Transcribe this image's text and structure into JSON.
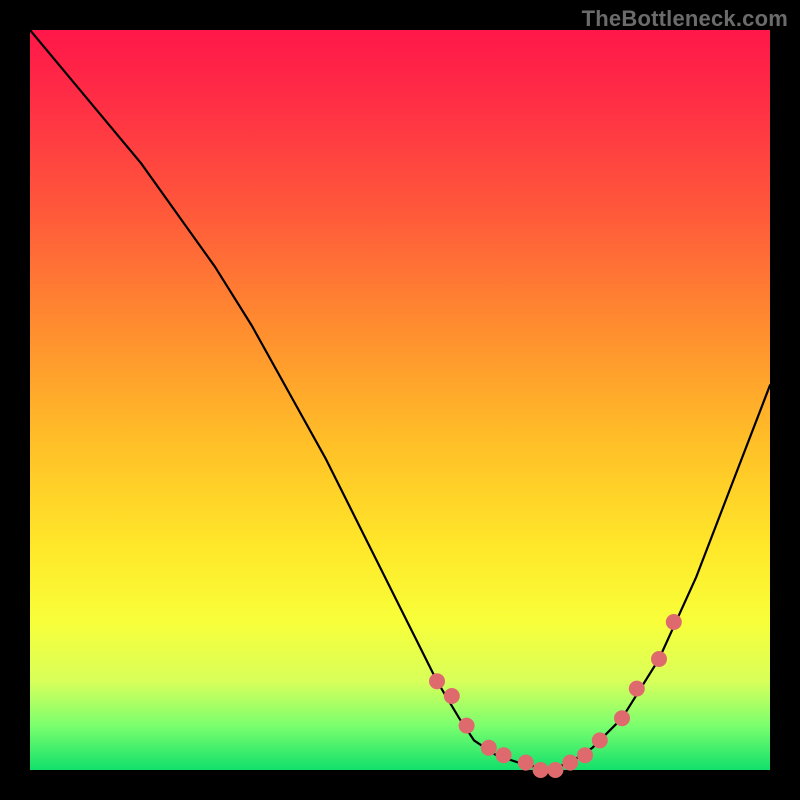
{
  "watermark": "TheBottleneck.com",
  "chart_data": {
    "type": "line",
    "title": "",
    "xlabel": "",
    "ylabel": "",
    "xlim": [
      0,
      100
    ],
    "ylim": [
      0,
      100
    ],
    "grid": false,
    "legend": false,
    "series": [
      {
        "name": "bottleneck-curve",
        "color": "#000000",
        "x": [
          0,
          5,
          10,
          15,
          20,
          25,
          30,
          35,
          40,
          45,
          50,
          52,
          55,
          58,
          60,
          63,
          66,
          70,
          73,
          76,
          80,
          85,
          90,
          95,
          100
        ],
        "y": [
          100,
          94,
          88,
          82,
          75,
          68,
          60,
          51,
          42,
          32,
          22,
          18,
          12,
          7,
          4,
          2,
          1,
          0,
          1,
          3,
          7,
          15,
          26,
          39,
          52
        ]
      }
    ],
    "markers": {
      "name": "highlight-dots",
      "color": "#df6a6d",
      "radius": 8,
      "x": [
        55,
        57,
        59,
        62,
        64,
        67,
        69,
        71,
        73,
        75,
        77,
        80,
        82,
        85,
        87
      ],
      "y": [
        12,
        10,
        6,
        3,
        2,
        1,
        0,
        0,
        1,
        2,
        4,
        7,
        11,
        15,
        20
      ]
    },
    "gradient_stops": [
      {
        "pos": 0,
        "color": "#ff1749"
      },
      {
        "pos": 10,
        "color": "#ff2f45"
      },
      {
        "pos": 25,
        "color": "#ff5a3a"
      },
      {
        "pos": 40,
        "color": "#ff8c2f"
      },
      {
        "pos": 55,
        "color": "#ffbd28"
      },
      {
        "pos": 70,
        "color": "#ffe829"
      },
      {
        "pos": 80,
        "color": "#f8ff3a"
      },
      {
        "pos": 88,
        "color": "#d8ff5a"
      },
      {
        "pos": 94,
        "color": "#7bff6e"
      },
      {
        "pos": 100,
        "color": "#11e06b"
      }
    ]
  }
}
